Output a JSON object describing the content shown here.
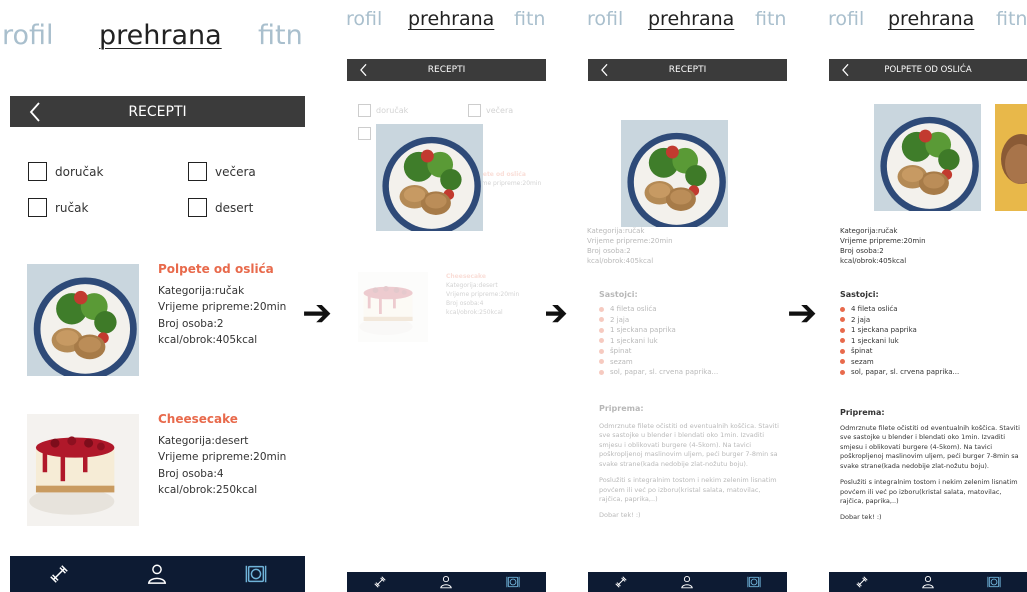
{
  "nav": {
    "left": "rofil",
    "active": "prehrana",
    "right": "fitn"
  },
  "header": {
    "recipes_title": "RECEPTI",
    "detail_title": "POLPETE OD OSLIĆA"
  },
  "filters": {
    "breakfast": "doručak",
    "dinner": "večera",
    "lunch": "ručak",
    "dessert": "desert"
  },
  "recipes": [
    {
      "name": "Polpete od oslića",
      "category": "Kategorija:ručak",
      "prep": "Vrijeme pripreme:20min",
      "persons": "Broj osoba:2",
      "kcal": "kcal/obrok:405kcal"
    },
    {
      "name": "Cheesecake",
      "category": "Kategorija:desert",
      "prep": "Vrijeme pripreme:20min",
      "persons": "Broj osoba:4",
      "kcal": "kcal/obrok:250kcal"
    }
  ],
  "detail": {
    "ingredients_title": "Sastojci:",
    "ingredients": [
      "4 fileta oslića",
      "2 jaja",
      "1 sjeckana paprika",
      "1 sjeckani luk",
      "špinat",
      "sezam",
      "sol, papar, sl. crvena paprika..."
    ],
    "prep_title": "Priprema:",
    "prep_p1": "Odmrznute filete očistiti od eventualnih koščica. Staviti sve sastojke u blender i blendati oko 1min. Izvaditi smjesu i oblikovati burgere (4-5kom). Na tavici poškropljenoj maslinovim uljem, peći burger 7-8min sa svake strane(kada nedobije zlat-nožutu boju).",
    "prep_p2": "Poslužiti s integralnim tostom i nekim zelenim lisnatim povćem ili već po izboru(kristal salata, matovilac, rajčica, paprika,..)",
    "prep_p3": "Dobar tek! :)"
  },
  "arrow": "➔",
  "icons": {
    "fitness": "dumbbell-icon",
    "profile": "person-icon",
    "nutrition": "plate-icon",
    "back": "chevron-left-icon"
  },
  "colors": {
    "accent": "#e86a4c",
    "header_bg": "#3b3b3b",
    "bottom_bg": "#0d1b33",
    "nav_muted": "#a9bfcd",
    "active_icon": "#6fb3d9"
  }
}
